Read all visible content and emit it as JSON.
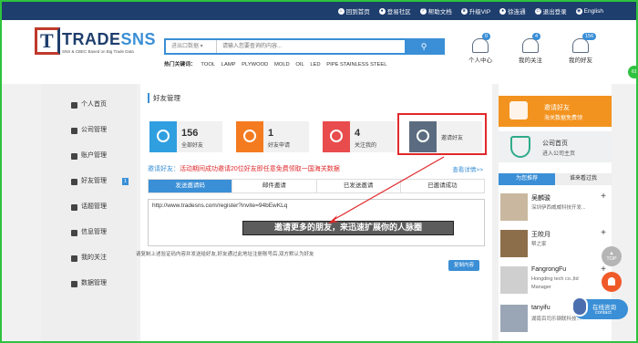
{
  "topbar": {
    "links": [
      {
        "icon": "home-icon",
        "label": "回到首页"
      },
      {
        "icon": "community-icon",
        "label": "登易社区"
      },
      {
        "icon": "help-icon",
        "label": "帮助文档"
      },
      {
        "icon": "vip-icon",
        "label": "升级VIP"
      },
      {
        "icon": "user-icon",
        "label": "徐连通"
      },
      {
        "icon": "logout-icon",
        "label": "退出登录"
      },
      {
        "icon": "language-icon",
        "label": "English"
      }
    ]
  },
  "logo": {
    "mark": "T",
    "brand_a": "TRADE",
    "brand_b": "SNS",
    "tagline": "SNS & CBEC Based on Big Trade Data"
  },
  "search": {
    "category": "进出口数据 ▾",
    "placeholder": "请输入您要查询的内容...",
    "button_icon": "search-icon",
    "hot_label": "热门关键词：",
    "hot_words": [
      "TOOL",
      "LAMP",
      "PLYWOOD",
      "MOLD",
      "OIL",
      "LED",
      "PIPE STAINLESS STEEL"
    ]
  },
  "header_icons": [
    {
      "icon": "person-icon",
      "count": "0",
      "label": "个人中心"
    },
    {
      "icon": "heart-icon",
      "count": "4",
      "label": "我的关注"
    },
    {
      "icon": "friends-icon",
      "count": "156",
      "label": "我的好友"
    }
  ],
  "sidebar": {
    "items": [
      {
        "icon": "home-icon",
        "label": "个人首页",
        "count": ""
      },
      {
        "icon": "building-icon",
        "label": "公司管理",
        "count": ""
      },
      {
        "icon": "gear-icon",
        "label": "账户管理",
        "count": ""
      },
      {
        "icon": "friends-icon",
        "label": "好友管理",
        "count": "1"
      },
      {
        "icon": "edit-icon",
        "label": "话题管理",
        "count": ""
      },
      {
        "icon": "envelope-icon",
        "label": "信息管理",
        "count": ""
      },
      {
        "icon": "heart-icon",
        "label": "我的关注",
        "count": ""
      },
      {
        "icon": "chart-icon",
        "label": "数据管理",
        "count": ""
      }
    ]
  },
  "content": {
    "title": "好友管理",
    "stats": [
      {
        "icon": "friends-icon",
        "color": "#2f9fe0",
        "value": "156",
        "label": "全部好友"
      },
      {
        "icon": "search-icon",
        "color": "#f47b20",
        "value": "1",
        "label": "好友申请"
      },
      {
        "icon": "heart-icon",
        "color": "#e84c4c",
        "value": "4",
        "label": "关注我的"
      },
      {
        "icon": "heart-icon",
        "color": "#5b6c80",
        "value": "",
        "label": "邀请好友"
      }
    ],
    "invite_prefix": "邀请好友：",
    "invite_promo": "活动期间成功邀请20位好友即任意免费领取一国海关数据",
    "details_link": "查看详情>>",
    "tabs": [
      "发送邀请码",
      "邮件邀请",
      "已发送邀请",
      "已邀请成功"
    ],
    "invite_url": "http://www.tradesns.com/register?invite=94bEwKLq",
    "callout": "邀请更多的朋友，来迅速扩展你的人脉圈",
    "hint": "请复制上述验证码内容并发送给好友,好友通过此地址注册账号后,双方默认为好友",
    "copy_button": "复制内容"
  },
  "right": {
    "invite_card": {
      "title": "邀请好友",
      "subtitle": "海关数据免费领"
    },
    "company_card": {
      "title": "公司首页",
      "subtitle": "进入公司主页"
    },
    "tabs": [
      "为您推荐",
      "谁来看过我"
    ],
    "people": [
      {
        "name": "吴麟骏",
        "sub": "深圳伊西威威科技开发..."
      },
      {
        "name": "王皎月",
        "sub": "帮之家"
      },
      {
        "name": "FangrongFu",
        "sub": "Hongding tech co.,ltd",
        "sub2": "Manager"
      },
      {
        "name": "tanyifu",
        "sub": "湖南百司乐钢联科技..."
      }
    ]
  },
  "floating": {
    "top": "TOP",
    "chat_title": "在线咨询",
    "chat_sub": "contact",
    "edge_badge": "61"
  }
}
